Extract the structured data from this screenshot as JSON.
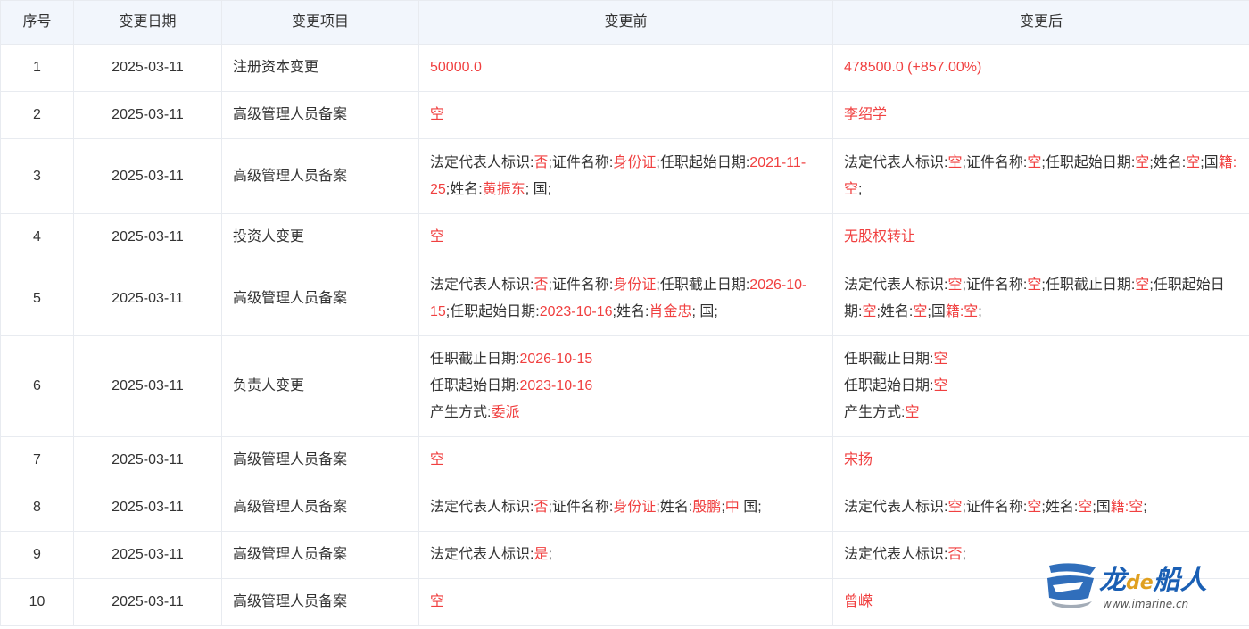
{
  "columns": [
    "序号",
    "变更日期",
    "变更项目",
    "变更前",
    "变更后"
  ],
  "rows": [
    {
      "index": "1",
      "date": "2025-03-11",
      "item": "注册资本变更",
      "before": [
        [
          {
            "t": "50000.0",
            "r": true
          }
        ]
      ],
      "after": [
        [
          {
            "t": "478500.0 (+857.00%)",
            "r": true
          }
        ]
      ]
    },
    {
      "index": "2",
      "date": "2025-03-11",
      "item": "高级管理人员备案",
      "before": [
        [
          {
            "t": "空",
            "r": true
          }
        ]
      ],
      "after": [
        [
          {
            "t": "李绍学",
            "r": true
          }
        ]
      ]
    },
    {
      "index": "3",
      "date": "2025-03-11",
      "item": "高级管理人员备案",
      "before": [
        [
          {
            "t": "法定代表人标识:",
            "r": false
          },
          {
            "t": "否",
            "r": true
          },
          {
            "t": ";证件名称:",
            "r": false
          },
          {
            "t": "身份证",
            "r": true
          },
          {
            "t": ";任职起始日期:",
            "r": false
          },
          {
            "t": "2021-11-25",
            "r": true
          },
          {
            "t": ";姓名:",
            "r": false
          },
          {
            "t": "黄振东",
            "r": true
          },
          {
            "t": "; 国;",
            "r": false
          }
        ]
      ],
      "after": [
        [
          {
            "t": "法定代表人标识:",
            "r": false
          },
          {
            "t": "空",
            "r": true
          },
          {
            "t": ";证件名称:",
            "r": false
          },
          {
            "t": "空",
            "r": true
          },
          {
            "t": ";任职起始日期:",
            "r": false
          },
          {
            "t": "空",
            "r": true
          },
          {
            "t": ";姓名:",
            "r": false
          },
          {
            "t": "空",
            "r": true
          },
          {
            "t": ";国",
            "r": false
          },
          {
            "t": "籍:空",
            "r": true
          },
          {
            "t": ";",
            "r": false
          }
        ]
      ]
    },
    {
      "index": "4",
      "date": "2025-03-11",
      "item": "投资人变更",
      "before": [
        [
          {
            "t": "空",
            "r": true
          }
        ]
      ],
      "after": [
        [
          {
            "t": "无股权转让",
            "r": true
          }
        ]
      ]
    },
    {
      "index": "5",
      "date": "2025-03-11",
      "item": "高级管理人员备案",
      "before": [
        [
          {
            "t": "法定代表人标识:",
            "r": false
          },
          {
            "t": "否",
            "r": true
          },
          {
            "t": ";证件名称:",
            "r": false
          },
          {
            "t": "身份证",
            "r": true
          },
          {
            "t": ";任职截止日期:",
            "r": false
          },
          {
            "t": "2026-10-15",
            "r": true
          },
          {
            "t": ";任职起始日期:",
            "r": false
          },
          {
            "t": "2023-10-16",
            "r": true
          },
          {
            "t": ";姓名:",
            "r": false
          },
          {
            "t": "肖金忠",
            "r": true
          },
          {
            "t": "; 国;",
            "r": false
          }
        ]
      ],
      "after": [
        [
          {
            "t": "法定代表人标识:",
            "r": false
          },
          {
            "t": "空",
            "r": true
          },
          {
            "t": ";证件名称:",
            "r": false
          },
          {
            "t": "空",
            "r": true
          },
          {
            "t": ";任职截止日期:",
            "r": false
          },
          {
            "t": "空",
            "r": true
          },
          {
            "t": ";任职起始日期:",
            "r": false
          },
          {
            "t": "空",
            "r": true
          },
          {
            "t": ";姓名:",
            "r": false
          },
          {
            "t": "空",
            "r": true
          },
          {
            "t": ";国",
            "r": false
          },
          {
            "t": "籍:空",
            "r": true
          },
          {
            "t": ";",
            "r": false
          }
        ]
      ]
    },
    {
      "index": "6",
      "date": "2025-03-11",
      "item": "负责人变更",
      "before": [
        [
          {
            "t": "任职截止日期:",
            "r": false
          },
          {
            "t": "2026-10-15",
            "r": true
          }
        ],
        [
          {
            "t": "任职起始日期:",
            "r": false
          },
          {
            "t": "2023-10-16",
            "r": true
          }
        ],
        [
          {
            "t": "产生方式:",
            "r": false
          },
          {
            "t": "委派",
            "r": true
          }
        ]
      ],
      "after": [
        [
          {
            "t": "任职截止日期:",
            "r": false
          },
          {
            "t": "空",
            "r": true
          }
        ],
        [
          {
            "t": "任职起始日期:",
            "r": false
          },
          {
            "t": "空",
            "r": true
          }
        ],
        [
          {
            "t": "产生方式:",
            "r": false
          },
          {
            "t": "空",
            "r": true
          }
        ]
      ]
    },
    {
      "index": "7",
      "date": "2025-03-11",
      "item": "高级管理人员备案",
      "before": [
        [
          {
            "t": "空",
            "r": true
          }
        ]
      ],
      "after": [
        [
          {
            "t": "宋扬",
            "r": true
          }
        ]
      ]
    },
    {
      "index": "8",
      "date": "2025-03-11",
      "item": "高级管理人员备案",
      "before": [
        [
          {
            "t": "法定代表人标识:",
            "r": false
          },
          {
            "t": "否",
            "r": true
          },
          {
            "t": ";证件名称:",
            "r": false
          },
          {
            "t": "身份证",
            "r": true
          },
          {
            "t": ";姓名:",
            "r": false
          },
          {
            "t": "殷鹏",
            "r": true
          },
          {
            "t": ";",
            "r": false
          },
          {
            "t": "中",
            "r": true
          },
          {
            "t": " 国;",
            "r": false
          }
        ]
      ],
      "after": [
        [
          {
            "t": "法定代表人标识:",
            "r": false
          },
          {
            "t": "空",
            "r": true
          },
          {
            "t": ";证件名称:",
            "r": false
          },
          {
            "t": "空",
            "r": true
          },
          {
            "t": ";姓名:",
            "r": false
          },
          {
            "t": "空",
            "r": true
          },
          {
            "t": ";国",
            "r": false
          },
          {
            "t": "籍:空",
            "r": true
          },
          {
            "t": ";",
            "r": false
          }
        ]
      ]
    },
    {
      "index": "9",
      "date": "2025-03-11",
      "item": "高级管理人员备案",
      "before": [
        [
          {
            "t": "法定代表人标识:",
            "r": false
          },
          {
            "t": "是",
            "r": true
          },
          {
            "t": ";",
            "r": false
          }
        ]
      ],
      "after": [
        [
          {
            "t": "法定代表人标识:",
            "r": false
          },
          {
            "t": "否",
            "r": true
          },
          {
            "t": ";",
            "r": false
          }
        ]
      ]
    },
    {
      "index": "10",
      "date": "2025-03-11",
      "item": "高级管理人员备案",
      "before": [
        [
          {
            "t": "空",
            "r": true
          }
        ]
      ],
      "after": [
        [
          {
            "t": "曾嵘",
            "r": true
          }
        ]
      ]
    }
  ],
  "watermark": {
    "brand_prefix": "龙",
    "brand_mid": "de",
    "brand_suffix": "船人",
    "url": "www.imarine.cn"
  },
  "colors": {
    "highlight": "#f04040",
    "header_bg": "#f2f6fc",
    "border": "#e8ebf0",
    "text": "#333333",
    "brand_blue": "#1a5fb4"
  }
}
